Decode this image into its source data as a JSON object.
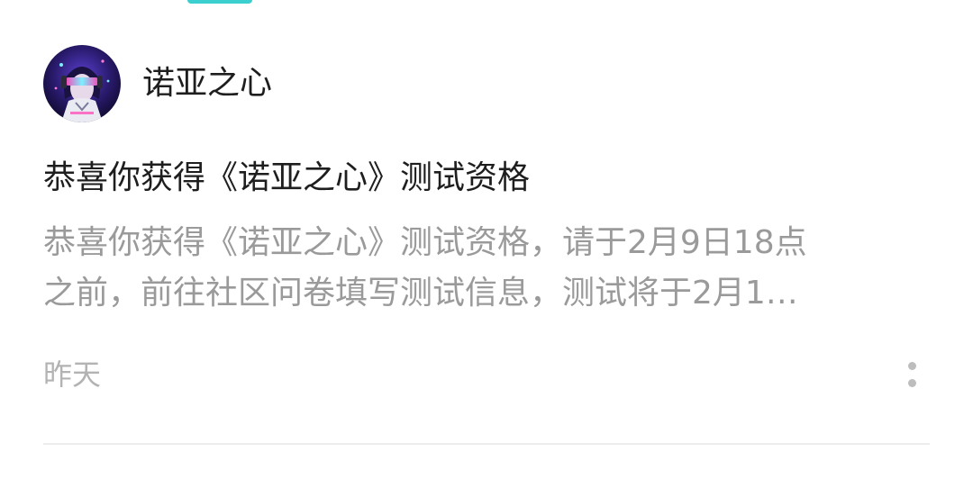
{
  "post": {
    "author": {
      "name": "诺亚之心",
      "avatar_icon": "cyberpunk-character-avatar"
    },
    "title": "恭喜你获得《诺亚之心》测试资格",
    "preview_line1": "恭喜你获得《诺亚之心》测试资格，请于2月9日18点",
    "preview_line2": "之前，前往社区问卷填写测试信息，测试将于2月1…",
    "time": "昨天",
    "more_icon": "more-vertical-icon"
  },
  "colors": {
    "accent": "#3ccfcf",
    "title_text": "#1e1e1e",
    "preview_text": "#9a9a9a",
    "time_text": "#b3b3b3",
    "divider": "#ececec"
  }
}
